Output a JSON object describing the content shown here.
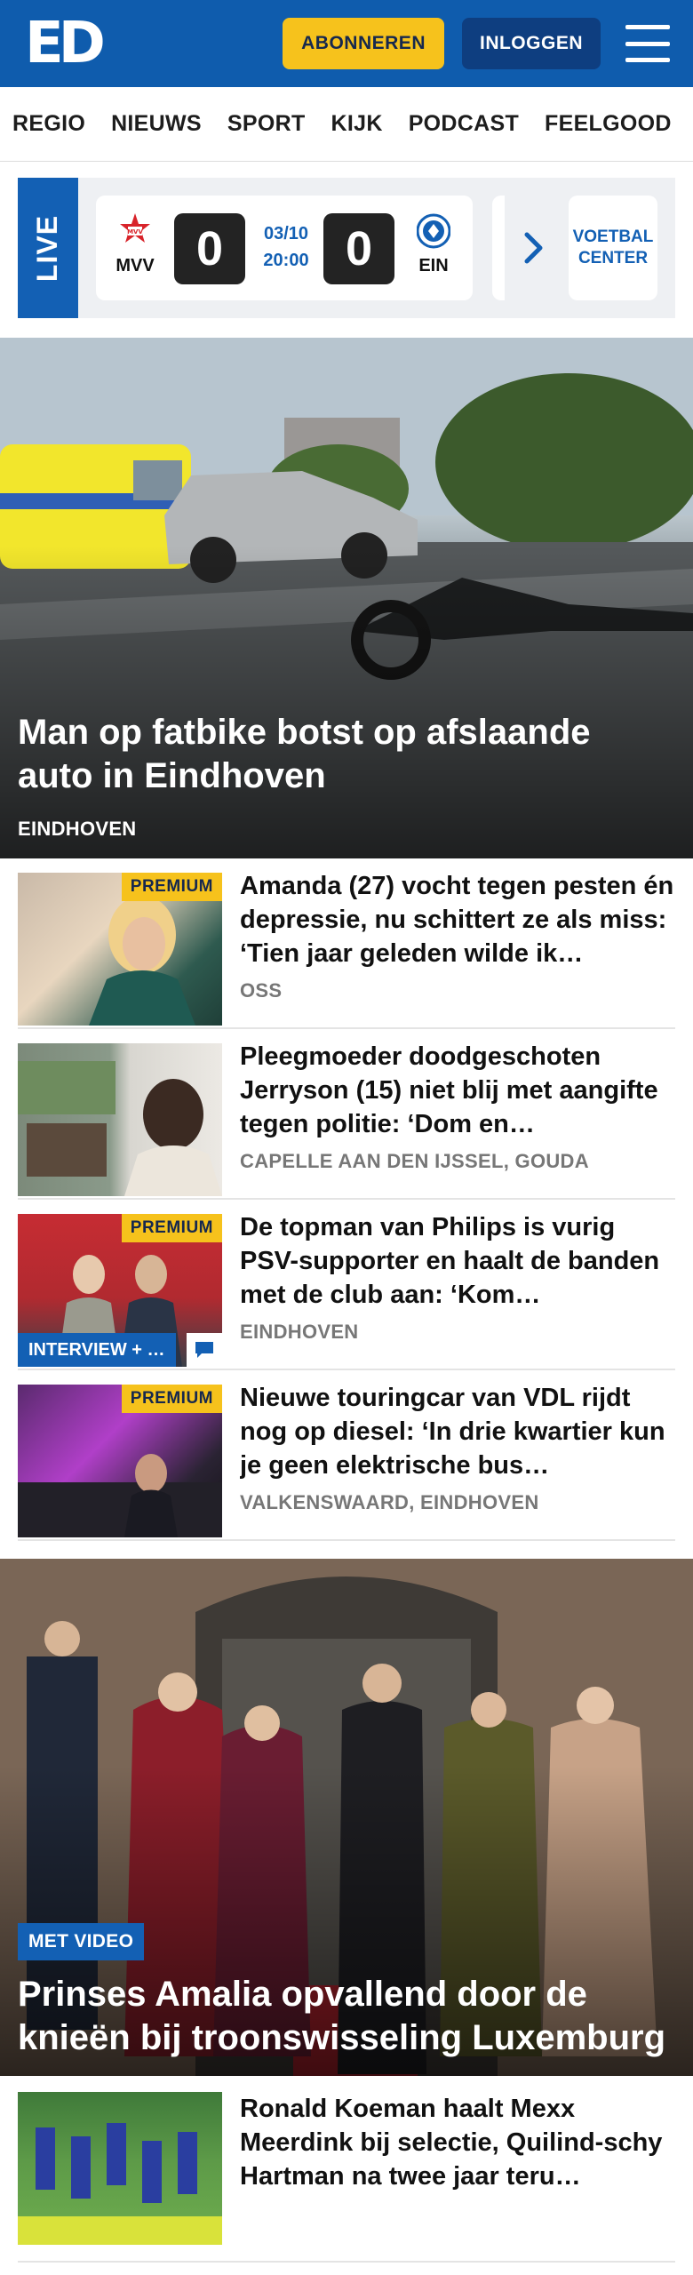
{
  "header": {
    "logo": "ED",
    "subscribe_label": "ABONNEREN",
    "login_label": "INLOGGEN",
    "menu_icon": "hamburger-icon",
    "colors": {
      "brand": "#0f5cad",
      "subscribe": "#f6c21c",
      "login": "#0e3e80"
    }
  },
  "nav": {
    "items": [
      {
        "label": "REGIO"
      },
      {
        "label": "NIEUWS"
      },
      {
        "label": "SPORT"
      },
      {
        "label": "KIJK"
      },
      {
        "label": "PODCAST"
      },
      {
        "label": "FEELGOOD"
      }
    ]
  },
  "live": {
    "label": "LIVE",
    "match": {
      "home_team": "MVV",
      "away_team": "EIN",
      "home_score": "0",
      "away_score": "0",
      "date": "03/10",
      "time": "20:00"
    },
    "next_icon": "chevron-right-icon",
    "football_center_label": "VOETBAL CENTER"
  },
  "hero_top": {
    "title": "Man op fatbike botst op afslaande auto in Eindhoven",
    "tag": "EINDHOVEN"
  },
  "articles": [
    {
      "title": "Amanda (27) vocht tegen pesten én depressie, nu schittert ze als miss: ‘Tien jaar geleden wilde ik…",
      "tag": "OSS",
      "premium": "PREMIUM"
    },
    {
      "title": "Pleegmoeder doodgeschoten Jerryson (15) niet blij met aangifte tegen politie: ‘Dom en…",
      "tag": "CAPELLE AAN DEN IJSSEL, GOUDA"
    },
    {
      "title": "De topman van Philips is vurig PSV-supporter en haalt de banden met de club aan: ‘Kom…",
      "tag": "EINDHOVEN",
      "premium": "PREMIUM",
      "label": "INTERVIEW + …",
      "comment_icon": "comment-icon"
    },
    {
      "title": "Nieuwe touringcar van VDL rijdt nog op diesel: ‘In drie kwartier kun je geen elektrische bus…",
      "tag": "VALKENSWAARD, EINDHOVEN",
      "premium": "PREMIUM"
    }
  ],
  "hero_second": {
    "badge": "MET VIDEO",
    "title": "Prinses Amalia opvallend door de knieën bij troonswisseling Luxemburg"
  },
  "article_last": {
    "title": "Ronald Koeman haalt Mexx Meerdink bij selectie, Quilind-schy Hartman na twee jaar teru…"
  }
}
